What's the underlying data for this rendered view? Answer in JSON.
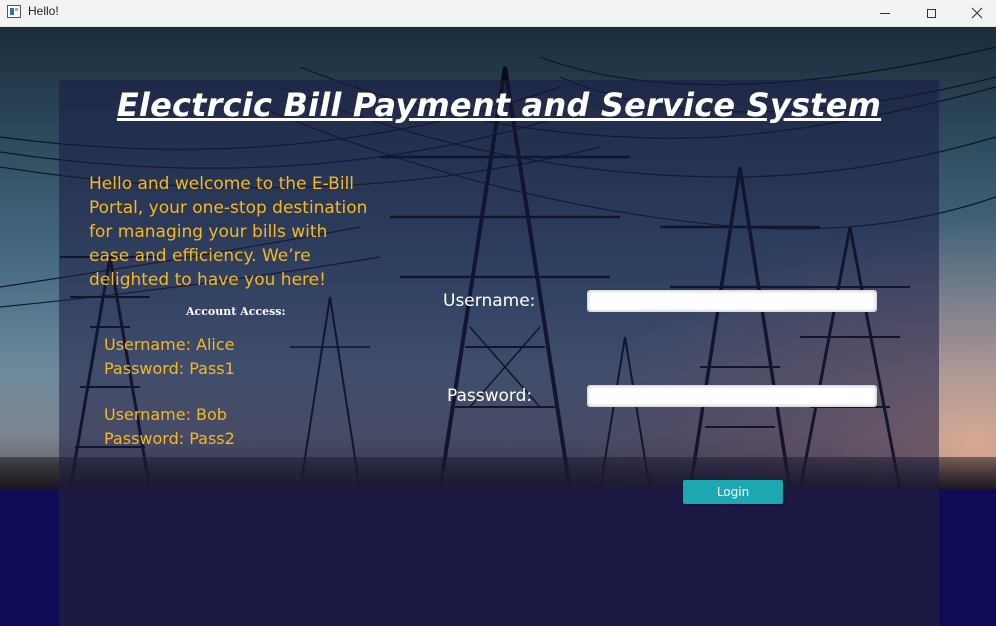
{
  "window": {
    "title": "Hello!",
    "icon": "app-window-icon",
    "controls": [
      "minimize",
      "maximize",
      "close"
    ]
  },
  "main": {
    "heading": "Electrcic Bill Payment and Service System",
    "welcome": "Hello and welcome to the E-Bill Portal, your one-stop destination for managing your bills with ease and efficiency. We’re delighted to have you here!",
    "account_access_label": "Account Access:",
    "accounts": [
      {
        "username_line": "Username: Alice",
        "password_line": "Password: Pass1"
      },
      {
        "username_line": "Username: Bob",
        "password_line": "Password: Pass2"
      }
    ]
  },
  "form": {
    "username_label": "Username:",
    "password_label": "Password:",
    "username_value": "",
    "password_value": "",
    "login_label": "Login"
  },
  "colors": {
    "accent_yellow": "#f5b820",
    "button_teal": "#1ba8b0",
    "navy": "#100b56"
  }
}
